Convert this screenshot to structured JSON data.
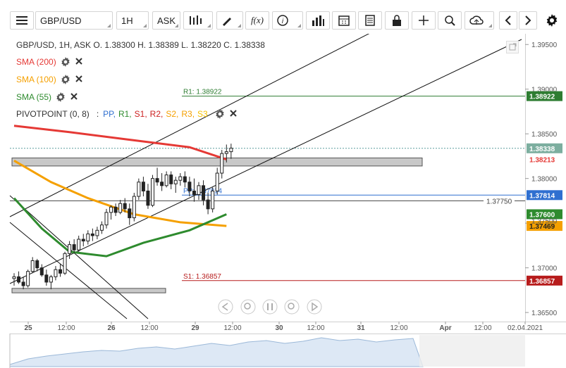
{
  "toolbar": {
    "symbol": "GBP/USD",
    "timeframe": "1H",
    "price_type": "ASK",
    "fx_label": "f(x)",
    "icons": [
      "menu-icon",
      "candles-icon",
      "draw-icon",
      "function-icon",
      "info-icon",
      "bars-icon",
      "calendar-icon",
      "news-icon",
      "lock-icon",
      "crosshair-icon",
      "zoom-icon",
      "cloud-upload-icon",
      "chevron-left-icon",
      "chevron-right-icon",
      "gear-icon"
    ]
  },
  "header": {
    "info": "GBP/USD, 1H, ASK   O. 1.38300 H. 1.38389 L. 1.38220 C. 1.38338"
  },
  "indicators": [
    {
      "label": "SMA (200)",
      "color": "#e53935"
    },
    {
      "label": "SMA (100)",
      "color": "#f5a000"
    },
    {
      "label": "SMA (55)",
      "color": "#2e8b2e"
    }
  ],
  "pivot": {
    "label": "PIVOTPOINT (0, 8)",
    "sep": ":",
    "parts": [
      {
        "t": "PP,",
        "c": "#2f6fd0"
      },
      {
        "t": "R1,",
        "c": "#2e8b2e"
      },
      {
        "t": "S1,",
        "c": "#cc2222"
      },
      {
        "t": "R2,",
        "c": "#cc2222"
      },
      {
        "t": "S2,",
        "c": "#f5a000"
      },
      {
        "t": "R3,",
        "c": "#f5a000"
      },
      {
        "t": "S3",
        "c": "#f5c000"
      }
    ]
  },
  "chart_data": {
    "type": "candlestick",
    "symbol": "GBP/USD",
    "timeframe": "1H",
    "ylim": [
      1.3643,
      1.3962
    ],
    "y_ticks": [
      1.365,
      1.37,
      1.375,
      1.38,
      1.385,
      1.39,
      1.395
    ],
    "y_tick_labels": [
      "1.36500",
      "1.37000",
      "1.37500",
      "1.38000",
      "1.38500",
      "1.39000",
      "1.39500"
    ],
    "x_ticks": [
      {
        "label": "25",
        "bold": true
      },
      {
        "label": "12:00",
        "bold": false
      },
      {
        "label": "26",
        "bold": true
      },
      {
        "label": "12:00",
        "bold": false
      },
      {
        "label": "29",
        "bold": true
      },
      {
        "label": "12:00",
        "bold": false
      },
      {
        "label": "30",
        "bold": true
      },
      {
        "label": "12:00",
        "bold": false
      },
      {
        "label": "31",
        "bold": true
      },
      {
        "label": "12:00",
        "bold": false
      },
      {
        "label": "Apr",
        "bold": true
      },
      {
        "label": "12:00",
        "bold": false
      },
      {
        "label": "02.04.2021",
        "bold": false
      }
    ],
    "pivots": [
      {
        "name": "R1",
        "label": "R1: 1.38922",
        "value": 1.38922,
        "color": "#2e7d32",
        "badge": "1.38922"
      },
      {
        "name": "PP",
        "label": "PP: 1.37814",
        "value": 1.37814,
        "color": "#2f6fd0",
        "badge": "1.37814"
      },
      {
        "name": "S1",
        "label": "S1: 1.36857",
        "value": 1.36857,
        "color": "#b71c1c",
        "badge": "1.36857"
      }
    ],
    "level_line": {
      "value": 1.3775,
      "label": "1.37750"
    },
    "last_price": {
      "value": 1.38338,
      "label": "1.38338"
    },
    "sma_values": [
      {
        "name": "SMA (200)",
        "value": 1.38213,
        "label": "1.38213",
        "color": "#e53935"
      },
      {
        "name": "SMA (55)",
        "value": 1.376,
        "label": "1.37600",
        "color": "#2e8b2e"
      },
      {
        "name": "SMA (100)",
        "value": 1.37469,
        "label": "1.37469",
        "color": "#f5a000"
      }
    ],
    "extra_tick": {
      "label": "1.37500"
    },
    "zones": [
      {
        "low": 1.3814,
        "high": 1.3823
      },
      {
        "low": 1.3672,
        "high": 1.3677
      }
    ],
    "candles": [
      [
        1.3688,
        1.3694,
        1.368,
        1.369
      ],
      [
        1.369,
        1.3696,
        1.3682,
        1.3684
      ],
      [
        1.3684,
        1.369,
        1.3676,
        1.368
      ],
      [
        1.368,
        1.3698,
        1.3678,
        1.3696
      ],
      [
        1.3696,
        1.3712,
        1.3694,
        1.3708
      ],
      [
        1.3708,
        1.371,
        1.3696,
        1.37
      ],
      [
        1.37,
        1.3704,
        1.369,
        1.3692
      ],
      [
        1.3692,
        1.3698,
        1.368,
        1.3684
      ],
      [
        1.3684,
        1.3692,
        1.3676,
        1.369
      ],
      [
        1.369,
        1.3702,
        1.3686,
        1.3698
      ],
      [
        1.3698,
        1.3704,
        1.369,
        1.3694
      ],
      [
        1.3694,
        1.3718,
        1.3692,
        1.3716
      ],
      [
        1.3716,
        1.373,
        1.371,
        1.3726
      ],
      [
        1.3726,
        1.3732,
        1.3716,
        1.372
      ],
      [
        1.372,
        1.3736,
        1.3718,
        1.3732
      ],
      [
        1.3732,
        1.3738,
        1.3724,
        1.373
      ],
      [
        1.373,
        1.3742,
        1.3726,
        1.3738
      ],
      [
        1.3738,
        1.3744,
        1.373,
        1.3736
      ],
      [
        1.3736,
        1.3746,
        1.3732,
        1.3742
      ],
      [
        1.3742,
        1.3752,
        1.3738,
        1.3748
      ],
      [
        1.3748,
        1.3766,
        1.3744,
        1.3762
      ],
      [
        1.3762,
        1.377,
        1.3754,
        1.3768
      ],
      [
        1.3768,
        1.3772,
        1.3758,
        1.3762
      ],
      [
        1.3762,
        1.3776,
        1.376,
        1.3772
      ],
      [
        1.3772,
        1.3778,
        1.3762,
        1.3766
      ],
      [
        1.3766,
        1.3772,
        1.3748,
        1.3756
      ],
      [
        1.3756,
        1.3784,
        1.3752,
        1.378
      ],
      [
        1.378,
        1.38,
        1.3776,
        1.3796
      ],
      [
        1.3796,
        1.3802,
        1.378,
        1.3786
      ],
      [
        1.3786,
        1.3794,
        1.3766,
        1.377
      ],
      [
        1.377,
        1.3804,
        1.3768,
        1.38
      ],
      [
        1.38,
        1.3812,
        1.3792,
        1.3796
      ],
      [
        1.3796,
        1.3806,
        1.3786,
        1.3792
      ],
      [
        1.3792,
        1.3808,
        1.379,
        1.3804
      ],
      [
        1.3804,
        1.3808,
        1.3788,
        1.3794
      ],
      [
        1.3794,
        1.3802,
        1.3784,
        1.3798
      ],
      [
        1.3798,
        1.3806,
        1.3792,
        1.3802
      ],
      [
        1.3802,
        1.3808,
        1.379,
        1.3796
      ],
      [
        1.3796,
        1.3802,
        1.378,
        1.3786
      ],
      [
        1.3786,
        1.38,
        1.3774,
        1.3782
      ],
      [
        1.3782,
        1.3796,
        1.3776,
        1.3792
      ],
      [
        1.3792,
        1.3798,
        1.377,
        1.3776
      ],
      [
        1.3776,
        1.3784,
        1.376,
        1.3766
      ],
      [
        1.3766,
        1.379,
        1.3762,
        1.3786
      ],
      [
        1.3786,
        1.3812,
        1.3782,
        1.3806
      ],
      [
        1.3806,
        1.3832,
        1.38,
        1.3828
      ],
      [
        1.3828,
        1.3838,
        1.3818,
        1.383
      ],
      [
        1.383,
        1.3839,
        1.3822,
        1.3834
      ]
    ],
    "sma200": [
      [
        0,
        1.3859
      ],
      [
        12,
        1.3852
      ],
      [
        24,
        1.3844
      ],
      [
        38,
        1.3835
      ],
      [
        46,
        1.38213
      ]
    ],
    "sma100": [
      [
        0,
        1.382
      ],
      [
        8,
        1.3796
      ],
      [
        16,
        1.3778
      ],
      [
        26,
        1.376
      ],
      [
        36,
        1.3751
      ],
      [
        46,
        1.37469
      ]
    ],
    "sma55": [
      [
        0,
        1.3778
      ],
      [
        6,
        1.3744
      ],
      [
        12,
        1.3718
      ],
      [
        20,
        1.3713
      ],
      [
        28,
        1.3728
      ],
      [
        38,
        1.3742
      ],
      [
        46,
        1.376
      ]
    ]
  },
  "controls": {
    "icons": [
      "chevron-left-icon",
      "zoom-out-icon",
      "pause-icon",
      "zoom-in-icon",
      "chevron-right-icon"
    ]
  }
}
